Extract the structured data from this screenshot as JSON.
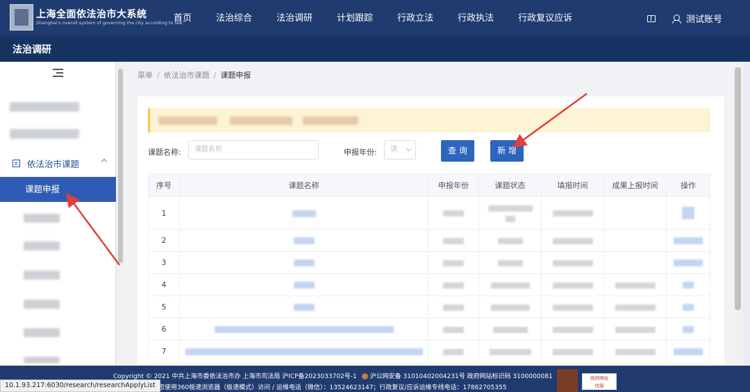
{
  "header": {
    "title": "上海全面依法治市大系统",
    "subtitle": "Shanghai's overall system of governing the city according to law",
    "nav": [
      "首页",
      "法治综合",
      "法治调研",
      "计划跟踪",
      "行政立法",
      "行政执法",
      "行政复议应诉"
    ],
    "user": "测试账号"
  },
  "subheader": {
    "title": "法治调研"
  },
  "sidebar": {
    "group_label": "依法治市课题",
    "active_item": "课题申报"
  },
  "breadcrumb": [
    "菜单",
    "依法治市课题",
    "课题申报"
  ],
  "filters": {
    "name_label": "课题名称:",
    "name_placeholder": "课题名称",
    "year_label": "申报年份:",
    "year_placeholder": "请",
    "query_btn": "查 询",
    "add_btn": "新 增"
  },
  "table": {
    "headers": [
      "序号",
      "课题名称",
      "申报年份",
      "课题状态",
      "填报时间",
      "成果上报时间",
      "操作"
    ],
    "rows": [
      "1",
      "2",
      "3",
      "4",
      "5",
      "6",
      "7"
    ]
  },
  "footer": {
    "line1_a": "Copyright © 2021 中共上海市委依法治市办 上海市司法局 沪ICP备2023033702号-1",
    "line1_b": "沪公网安备 31010402004231号 政府网站标识码 3100000081",
    "line2": "建议您使用360极速浏览器（极速模式）访问 / 运维电话（微信）：13524623147；行政复议/应诉运维专线电话：17862705355",
    "gov_badge_line1": "政府网站",
    "gov_badge_line2": "找错"
  },
  "status_url": "10.1.93.217:6030/research/researchApplyList",
  "colors": {
    "header": "#1f3b6f",
    "active": "#2d5bb4",
    "button": "#2d64bd",
    "arrow": "#e0403a"
  }
}
